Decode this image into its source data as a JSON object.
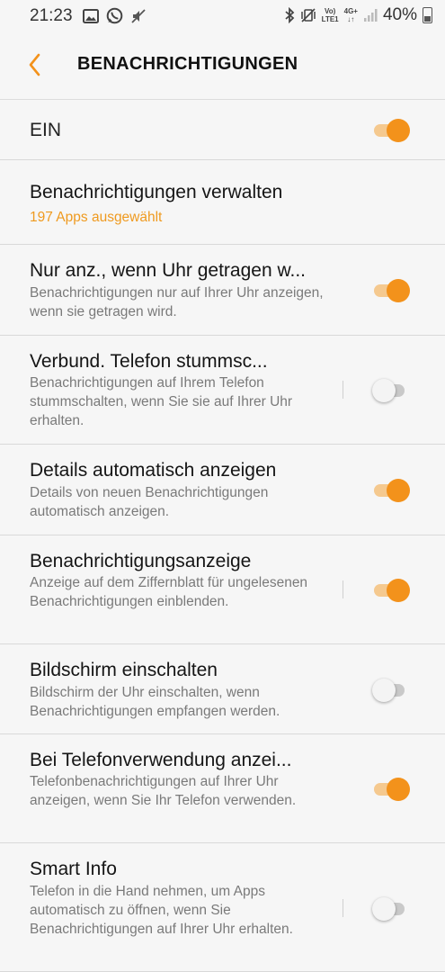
{
  "status_bar": {
    "time": "21:23",
    "net_top": "Vo)",
    "net_bottom": "LTE1",
    "net_gen": "4G+",
    "battery": "40%",
    "icons": [
      "image-icon",
      "whatsapp-icon",
      "mute-icon",
      "bluetooth-icon",
      "vibrate-icon",
      "signal-icon",
      "battery-icon"
    ]
  },
  "header": {
    "title": "BENACHRICHTIGUNGEN"
  },
  "master": {
    "label": "EIN",
    "on": true
  },
  "manage": {
    "title": "Benachrichtigungen verwalten",
    "subtitle": "197 Apps ausgewählt"
  },
  "settings": [
    {
      "title": "Nur anz., wenn Uhr getragen w...",
      "desc": "Benachrichtigungen nur auf Ihrer Uhr anzeigen, wenn sie getragen wird.",
      "on": true
    },
    {
      "title": "Verbund. Telefon stummsc...",
      "desc": "Benachrichtigungen auf Ihrem Telefon stummschalten, wenn Sie sie auf Ihrer Uhr erhalten.",
      "on": false
    },
    {
      "title": "Details automatisch anzeigen",
      "desc": "Details von neuen Benachrichtigungen automatisch anzeigen.",
      "on": true
    },
    {
      "title": "Benachrichtigungsanzeige",
      "desc": "Anzeige auf dem Ziffernblatt für ungelesenen Benachrichtigungen einblenden.",
      "on": true
    },
    {
      "title": "Bildschirm einschalten",
      "desc": "Bildschirm der Uhr einschalten, wenn Benachrichtigungen empfangen werden.",
      "on": false
    },
    {
      "title": "Bei Telefonverwendung anzei...",
      "desc": "Telefonbenachrichtigungen auf Ihrer Uhr anzeigen, wenn Sie Ihr Telefon verwenden.",
      "on": true
    },
    {
      "title": "Smart Info",
      "desc": "Telefon in die Hand nehmen, um Apps automatisch zu öffnen, wenn Sie Benachrichtigungen auf Ihrer Uhr erhalten.",
      "on": false
    }
  ],
  "colors": {
    "accent": "#f3921b",
    "accent_track": "#f5c98f",
    "background": "#f6f6f6"
  }
}
